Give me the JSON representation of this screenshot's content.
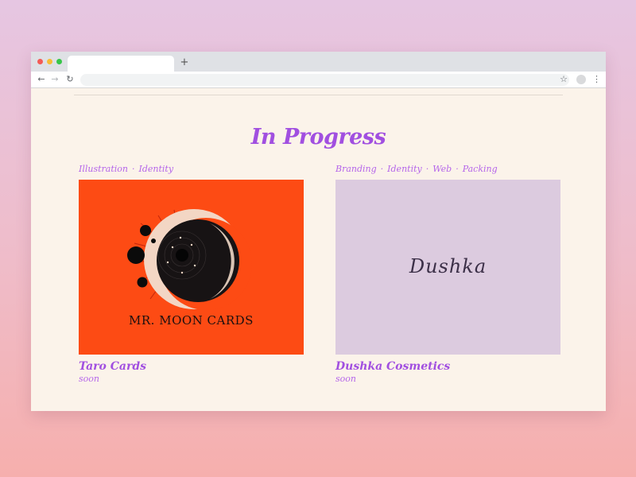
{
  "browser": {
    "tab_title": "",
    "new_tab_label": "+",
    "address": "",
    "icons": [
      "back-arrow-icon",
      "forward-arrow-icon",
      "reload-icon",
      "star-icon",
      "profile-icon",
      "menu-icon"
    ]
  },
  "section": {
    "title": "In Progress"
  },
  "projects": [
    {
      "tags": [
        "Illustration",
        "Identity"
      ],
      "title": "Taro Cards",
      "status": "soon",
      "thumb_text": "MR. MOON CARDS",
      "thumb_color": "#fd4b14"
    },
    {
      "tags": [
        "Branding",
        "Identity",
        "Web",
        "Packing"
      ],
      "title": "Dushka Cosmetics",
      "status": "soon",
      "thumb_text": "Dushka",
      "thumb_color": "#dccbdf"
    }
  ],
  "colors": {
    "accent": "#a14fe0",
    "page_bg": "#fbf3ea"
  }
}
